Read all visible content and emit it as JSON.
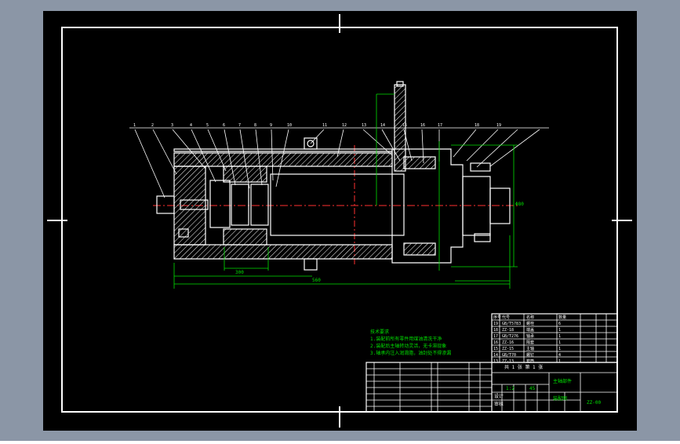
{
  "colors": {
    "workspace": "#8b96a6",
    "sheet": "#000000",
    "line": "#ffffff",
    "dim": "#00e000",
    "center": "#ff3030",
    "hatch": "#ffffff"
  },
  "drawing": {
    "balloons": [
      "1",
      "2",
      "3",
      "4",
      "5",
      "6",
      "7",
      "8",
      "9",
      "10",
      "11",
      "12",
      "13",
      "14",
      "15",
      "16",
      "17",
      "18",
      "19"
    ],
    "tech_notes": [
      "技术要求",
      "1.装配前所有零件用煤油清洗干净",
      "2.装配后主轴转动灵活，无卡滞现象",
      "3.轴承内注入润滑脂，油封处不得渗漏"
    ],
    "main_dims": {
      "overall_length": "560",
      "front_length": "300",
      "bore_diameter": "Φ80"
    }
  },
  "title_block": {
    "part_name": "主轴部件",
    "drawing_no": "ZZ-00",
    "scale": "1:2",
    "material": "45",
    "sheet_label": "共 1 张  第 1 张",
    "designer_label": "设计",
    "checker_label": "审核",
    "school": "装配图"
  },
  "parts_table": {
    "rows": [
      [
        "19",
        "GB/T5783",
        "螺栓",
        "6"
      ],
      [
        "18",
        "ZZ-18",
        "端盖",
        "1"
      ],
      [
        "17",
        "GB/T276",
        "轴承",
        "1"
      ],
      [
        "16",
        "ZZ-16",
        "隔套",
        "1"
      ],
      [
        "15",
        "ZZ-15",
        "主轴",
        "1"
      ],
      [
        "14",
        "GB/T70",
        "螺钉",
        "4"
      ],
      [
        "13",
        "ZZ-13",
        "套筒",
        "1"
      ]
    ],
    "header": [
      "序号",
      "代号",
      "名称",
      "数量"
    ]
  }
}
